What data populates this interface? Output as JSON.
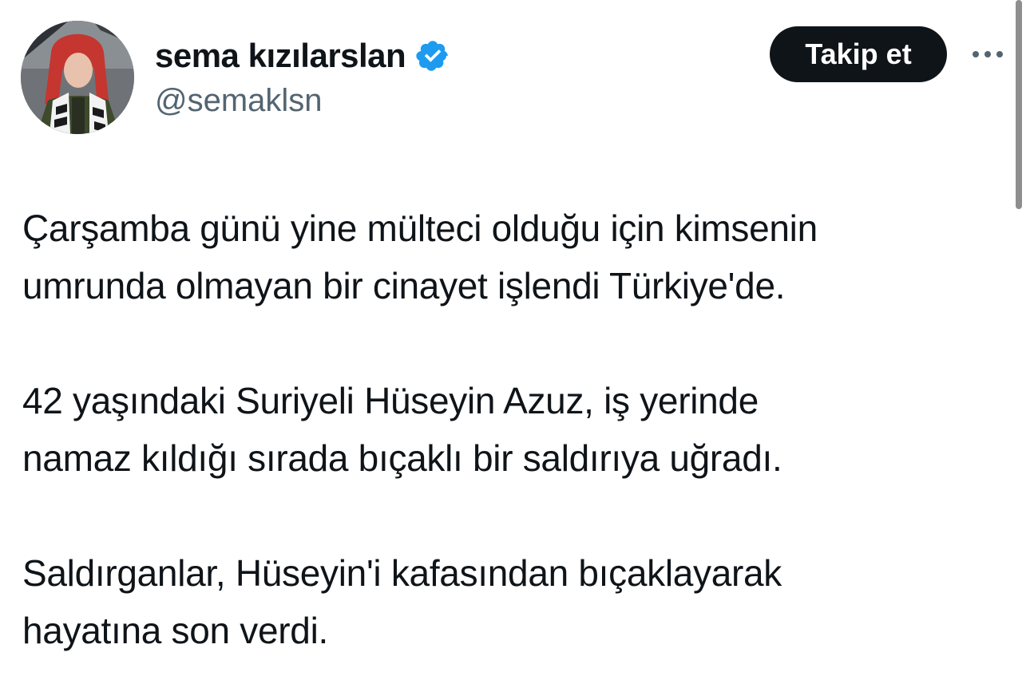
{
  "author": {
    "display_name": "sema kızılarslan",
    "handle": "@semaklsn",
    "verified": true,
    "badge_color": "#1d9bf0"
  },
  "actions": {
    "follow_label": "Takip et",
    "more_icon": "more-horizontal-icon"
  },
  "tweet": {
    "paragraphs": [
      [
        "Çarşamba günü yine mülteci olduğu için kimsenin",
        "umrunda olmayan bir cinayet işlendi Türkiye'de."
      ],
      [
        "42 yaşındaki Suriyeli Hüseyin Azuz, iş yerinde",
        "namaz kıldığı sırada bıçaklı bir saldırıya uğradı."
      ],
      [
        "Saldırganlar, Hüseyin'i kafasından bıçaklayarak",
        "hayatına son verdi."
      ]
    ]
  },
  "colors": {
    "text": "#0f1419",
    "secondary_text": "#536471",
    "follow_button_bg": "#0f1419",
    "follow_button_text": "#ffffff"
  }
}
